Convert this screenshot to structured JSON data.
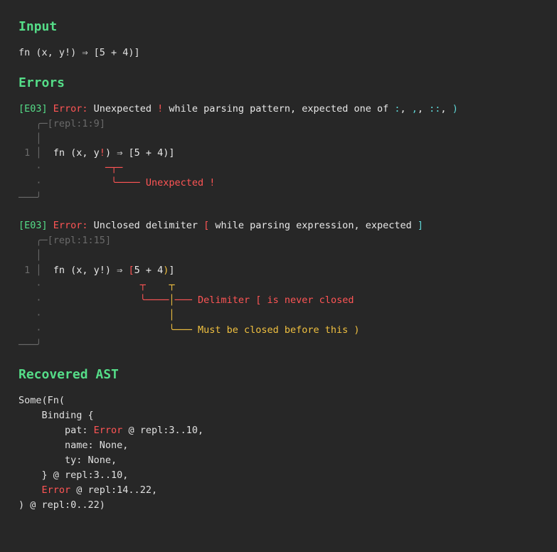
{
  "sections": {
    "input": "Input",
    "errors": "Errors",
    "ast": "Recovered AST"
  },
  "input_code": "fn (x, y!) ⇒ [5 + 4)]",
  "err1": {
    "code": "[E03]",
    "label": " Error:",
    "msg_a": " Unexpected ",
    "bang": "!",
    "msg_b": " while parsing pattern, expected one of ",
    "p1": ":",
    "c1": ", ",
    "p2": ",",
    "c2": ", ",
    "p3": "::",
    "c3": ", ",
    "p4": ")",
    "loc_open": "   ╭─[",
    "loc": "repl:1:9",
    "loc_close": "]",
    "gut_blank": "   │",
    "gut_num": " 1 │",
    "code_pre": "  fn (x, y",
    "code_bang": "!",
    "code_post": ") ⇒ [5 + 4)]",
    "gut_dot": "   ·",
    "mark_line": "           ─┬─",
    "msg_line_pre": "            ╰──── Unexpected ",
    "msg_line_bang": "!",
    "corner": "───╯"
  },
  "err2": {
    "code": "[E03]",
    "label": " Error:",
    "msg_a": " Unclosed delimiter ",
    "brk": "[",
    "msg_b": " while parsing expression, expected ",
    "cls": "]",
    "loc_open": "   ╭─[",
    "loc": "repl:1:15",
    "loc_close": "]",
    "gut_blank": "   │",
    "gut_num": " 1 │",
    "code_pre": "  fn (x, y!) ⇒ ",
    "code_brk": "[",
    "code_mid": "5 + 4",
    "code_paren": ")",
    "code_post": "]",
    "gut_dot": "   ·",
    "mark_red": "                 ┬",
    "mark_ylw": "    ┬",
    "line2_red": "                 ╰────",
    "line2_ylw": "│",
    "line2_msg_a": "─── Delimiter ",
    "line2_brk": "[",
    "line2_msg_b": " is never closed",
    "line3_pad": "                      ",
    "line3_ylw": "│",
    "line4_pad": "                      ",
    "line4_ylw": "╰─── ",
    "line4_msg_a": "Must be closed before this ",
    "line4_paren": ")",
    "corner": "───╯"
  },
  "ast": {
    "l1": "Some(Fn(",
    "l2": "    Binding {",
    "l3a": "        pat: ",
    "l3b": "Error",
    "l3c": " @ repl:3..10,",
    "l4": "        name: None,",
    "l5": "        ty: None,",
    "l6": "    } @ repl:3..10,",
    "l7a": "    ",
    "l7b": "Error",
    "l7c": " @ repl:14..22,",
    "l8": ") @ repl:0..22)"
  }
}
